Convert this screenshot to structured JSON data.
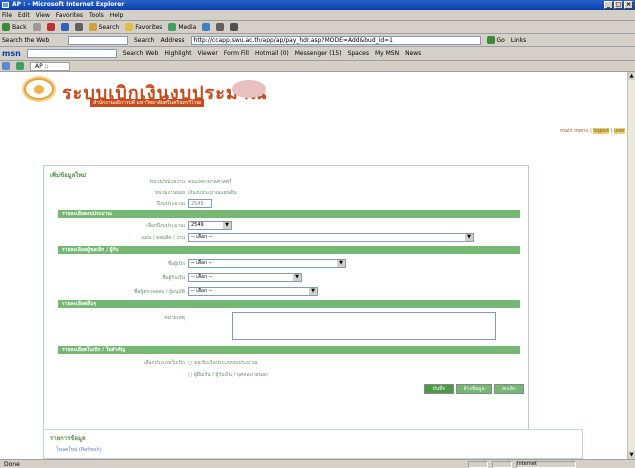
{
  "window": {
    "title": "AP : - Microsoft Internet Explorer",
    "controls": [
      "_",
      "□",
      "×"
    ]
  },
  "menu": [
    "File",
    "Edit",
    "View",
    "Favorites",
    "Tools",
    "Help"
  ],
  "toolbar": {
    "back": "Back",
    "search": "Search",
    "favorites": "Favorites",
    "media": "Media"
  },
  "search_web": {
    "label": "Search the Web",
    "search_btn": "Search",
    "address_label": "Address",
    "url": "http://ccapp.swu.ac.th/app/ap/pay_hdr.asp?MODE=Add&bud_id=1",
    "go": "Go",
    "links": "Links"
  },
  "msn": {
    "logo": "msn",
    "search_web": "Search Web",
    "highlight": "Highlight",
    "viewer": "Viewer",
    "form_fill": "Form Fill",
    "hotmail": "Hotmail (0)",
    "messenger": "Messenger (15)",
    "spaces": "Spaces",
    "my_msn": "My MSN",
    "news": "News"
  },
  "tab": {
    "label": "AP ::"
  },
  "banner": {
    "title": "ระบบเบิกเงินงบประมาณ",
    "subtitle": "สำนักงานอธิการบดี มหาวิทยาลัยศรีนครินทรวิโรฒ"
  },
  "user_links": {
    "main_menu": "main menu",
    "logout": "logout",
    "user": "user"
  },
  "form": {
    "header": "เพิ่มข้อมูลใหม่",
    "fields": [
      {
        "label": "หน่วย/หน่วยงาน",
        "value": "คณะพยาบาลศาสตร์"
      },
      {
        "label": "หน่วยงานย่อย",
        "value": "เงินงบประมาณแผ่นดิน"
      },
      {
        "label": "ปีงบประมาณ",
        "value": "2549"
      }
    ],
    "sections": [
      "รายละเอียดงบประมาณ",
      "รายละเอียดผู้ขอเบิก / ผู้รับ",
      "รายละเอียดอื่นๆ",
      "รายละเอียดใบเบิก / ใบสำคัญ"
    ],
    "budget_year": {
      "label": "เลือกปีงบประมาณ",
      "value": "2549"
    },
    "plan": {
      "label": "แผน / ผลผลิต / งาน",
      "value": "-- เลือก --"
    },
    "payee_name": {
      "label": "ชื่อผู้เบิก",
      "value": "-- เลือก --"
    },
    "payee_receiver": {
      "label": "ชื่อผู้รับเงิน",
      "value": "-- เลือก --"
    },
    "approver": {
      "label": "ชื่อผู้ตรวจสอบ / ผู้อนุมัติ",
      "value": "-- เลือก --"
    },
    "note": {
      "label": "หมายเหตุ"
    },
    "doc_type": {
      "label": "เลือกประเภทใบเบิก",
      "options": [
        "ขอเบิกเงินประเภทงบประมาณ",
        "ผู้ยืมเงิน / ผู้รับเงิน / บุคคลภายนอก"
      ]
    },
    "buttons": {
      "save": "บันทึก",
      "save_more": "ล้างข้อมูล",
      "cancel": "ยกเลิก"
    }
  },
  "list": {
    "header": "รายการข้อมูล",
    "item": "โหลดใหม่ (Refresh)"
  },
  "statusbar": {
    "text": "Done",
    "zone": "Internet"
  },
  "colors": {
    "header_green": "#74b874",
    "banner_orange": "#c94a1a",
    "label_green": "#6a8f6a"
  }
}
